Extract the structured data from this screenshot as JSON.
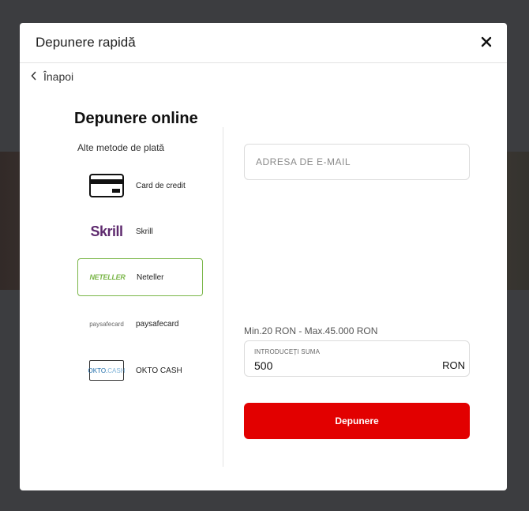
{
  "modal": {
    "title": "Depunere rapidă",
    "back_label": "Înapoi"
  },
  "online": {
    "section_title": "Depunere online",
    "methods_label": "Alte metode de plată",
    "methods": [
      {
        "label": "Card de credit",
        "icon": "credit-card-icon"
      },
      {
        "label": "Skrill",
        "logo_text": "Skrill"
      },
      {
        "label": "Neteller",
        "logo_text": "NETELLER",
        "selected": true
      },
      {
        "label": "paysafecard",
        "logo_text": "paysafecard"
      },
      {
        "label": "OKTO CASH",
        "logo_text_a": "OKTO.",
        "logo_text_b": "CASH"
      }
    ]
  },
  "form": {
    "email_placeholder": "ADRESA DE E-MAIL",
    "limits": "Min.20 RON - Max.45.000 RON",
    "amount_label": "INTRODUCEȚI SUMA",
    "amount_value": "500",
    "currency": "RON",
    "submit_label": "Depunere"
  },
  "colors": {
    "accent_red": "#e20000",
    "selected_border": "#7ab648",
    "skrill_purple": "#5e2a6e"
  }
}
